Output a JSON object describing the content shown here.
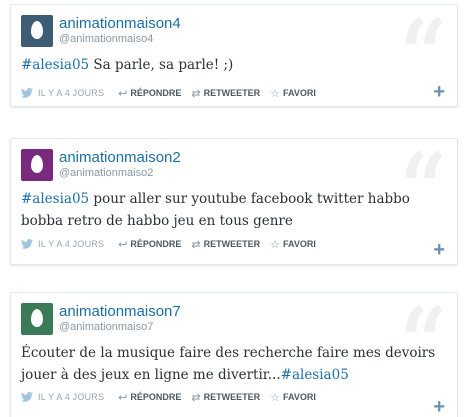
{
  "tweets": [
    {
      "display_name": "animationmaison4",
      "handle": "@animationmaiso4",
      "avatar_color": "#3e5c73",
      "hashtag": "#alesia05",
      "text_after": " Sa parle, sa parle! ;)",
      "text_before": "",
      "time": "IL Y A 4 JOURS"
    },
    {
      "display_name": "animationmaison2",
      "handle": "@animationmaiso2",
      "avatar_color": "#7a2a7e",
      "hashtag": "#alesia05",
      "text_after": " pour aller sur youtube facebook twitter habbo bobba retro de habbo jeu en tous genre",
      "text_before": "",
      "time": "IL Y A 4 JOURS"
    },
    {
      "display_name": "animationmaison7",
      "handle": "@animationmaiso7",
      "avatar_color": "#3b7a57",
      "hashtag": "#alesia05",
      "text_before": "Écouter de la musique faire des recherche faire mes devoirs jouer à des jeux en ligne me divertir...",
      "text_after": "",
      "time": "IL Y A 4 JOURS"
    }
  ],
  "actions": {
    "reply": "RÉPONDRE",
    "retweet": "RETWEETER",
    "favorite": "FAVORI"
  },
  "icons": {
    "bird": "twitter-bird-icon",
    "reply": "reply-arrow-icon",
    "retweet": "retweet-icon",
    "favorite": "star-icon",
    "expand": "plus-icon",
    "quote": "quote-mark-icon"
  },
  "colors": {
    "link": "#1c6fa8",
    "muted": "#8899a6",
    "border": "#e1e8ed"
  }
}
